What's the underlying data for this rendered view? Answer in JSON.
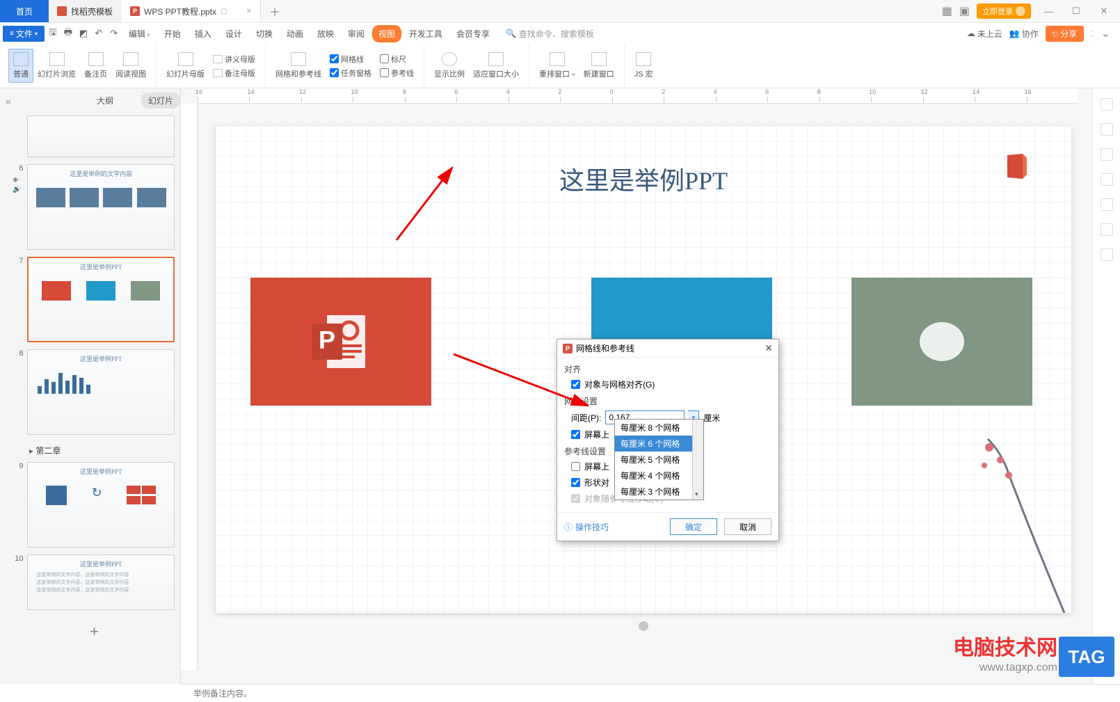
{
  "titlebar": {
    "home": "首页",
    "templates": "找稻壳模板",
    "doc_name": "WPS PPT教程.pptx",
    "doc_dropdown": "▫",
    "login": "立即登录"
  },
  "menubar": {
    "file": "文件",
    "items": [
      "编辑",
      "开始",
      "插入",
      "设计",
      "切换",
      "动画",
      "放映",
      "审阅",
      "视图",
      "开发工具",
      "会员专享"
    ],
    "active_index": 8,
    "search_placeholder": "查找命令、搜索模板",
    "cloud": "未上云",
    "collab": "协作",
    "share": "分享"
  },
  "ribbon": {
    "btns1": [
      "普通",
      "幻灯片浏览",
      "备注页",
      "阅读视图"
    ],
    "btns2": [
      "幻灯片母版",
      "讲义母版",
      "备注母版"
    ],
    "grid_guides": "网格和参考线",
    "checks_col1": [
      "网格线",
      "任务窗格"
    ],
    "checks_col2": [
      "标尺",
      "参考线"
    ],
    "checks_vals1": [
      true,
      true
    ],
    "checks_vals2": [
      false,
      false
    ],
    "btns3": [
      "显示比例",
      "适应窗口大小"
    ],
    "btns4": [
      "重排窗口",
      "新建窗口"
    ],
    "btns5": [
      "JS 宏"
    ]
  },
  "tabstrip": {
    "outline": "大纲",
    "slides": "幻灯片",
    "chapter": "第二章",
    "add": "+",
    "thumbs": [
      {
        "num": "",
        "sel": false
      },
      {
        "num": "6",
        "sel": false,
        "icons": true
      },
      {
        "num": "7",
        "sel": true
      },
      {
        "num": "8",
        "sel": false
      },
      {
        "num": "9",
        "sel": false
      },
      {
        "num": "10",
        "sel": false
      }
    ]
  },
  "slide": {
    "title": "这里是举例PPT"
  },
  "dialog": {
    "title": "网格线和参考线",
    "sec_align": "对齐",
    "chk_snap": "对象与网格对齐(G)",
    "sec_grid": "网格设置",
    "spacing_label": "间距(P):",
    "spacing_value": "0.167",
    "spacing_unit": "厘米",
    "chk_screen1": "屏幕上",
    "sec_guide": "参考线设置",
    "chk_screen2": "屏幕上",
    "chk_shape": "形状对",
    "chk_follow": "对象随参考线移动(O)",
    "tip": "操作技巧",
    "ok": "确定",
    "cancel": "取消",
    "dropdown": [
      "每厘米 8 个网格",
      "每厘米 6 个网格",
      "每厘米 5 个网格",
      "每厘米 4 个网格",
      "每厘米 3 个网格"
    ],
    "dd_selected": 1
  },
  "statusbar": {
    "notes": "举例备注内容。"
  },
  "watermark": {
    "main": "电脑技术网",
    "sub": "www.tagxp.com",
    "tag": "TAG"
  },
  "thumb_labels": {
    "example": "这里是举例PPT"
  }
}
